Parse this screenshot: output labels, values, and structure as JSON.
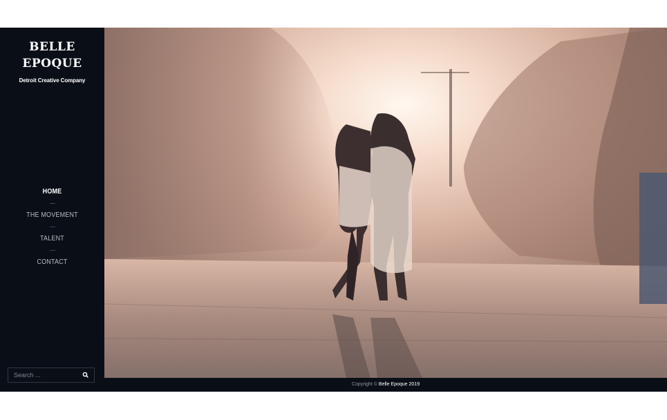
{
  "brand": {
    "line1": "BELLE",
    "line2": "EPOQUE",
    "tagline": "Detroit Creative Company"
  },
  "nav": {
    "items": [
      {
        "label": "HOME",
        "active": true
      },
      {
        "label": "THE MOVEMENT",
        "active": false
      },
      {
        "label": "TALENT",
        "active": false
      },
      {
        "label": "CONTACT",
        "active": false
      }
    ]
  },
  "search": {
    "placeholder": "Search ...",
    "icon": "search-icon"
  },
  "footer": {
    "prefix": "Copyright ©",
    "link": "Belle Epoque 2019"
  },
  "colors": {
    "sidebar_bg": "#0a0f17",
    "text": "#ffffff",
    "nav_text": "#b7bcc3"
  }
}
